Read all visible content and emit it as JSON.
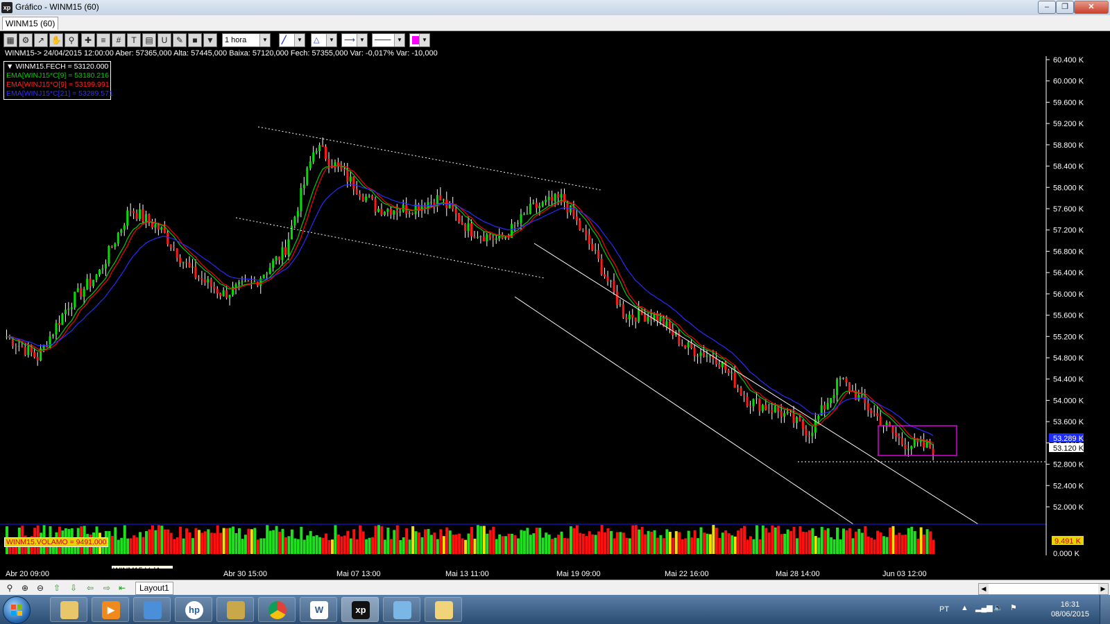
{
  "window": {
    "title": "Gráfico - WINM15 (60)",
    "app_icon": "xp"
  },
  "tab": {
    "label": "WINM15 (60)"
  },
  "toolbar": {
    "timeframe": "1 hora",
    "color_swatch": "#ff00ff"
  },
  "info": {
    "line": "WINM15-> 24/04/2015 12:00:00 Aber: 57365,000 Alta: 57445,000 Baixa: 57120,000 Fech: 57355,000 Var: -0,017% Var: -10,000"
  },
  "legend": {
    "close": "WINM15.FECH = 53120.000",
    "ema9c": "EMA[WINJ15*C[9] = 53180.216",
    "ema9o": "EMA[WINJ15*O[9] = 53199.991",
    "ema21c": "EMA[WINJ15*C[21] = 53289.571"
  },
  "price_axis": {
    "ticks": [
      "60.400 K",
      "60.000 K",
      "59.600 K",
      "59.200 K",
      "58.800 K",
      "58.400 K",
      "58.000 K",
      "57.600 K",
      "57.200 K",
      "56.800 K",
      "56.400 K",
      "56.000 K",
      "55.600 K",
      "55.200 K",
      "54.800 K",
      "54.400 K",
      "54.000 K",
      "53.600 K",
      "53.200 K",
      "52.800 K",
      "52.400 K",
      "52.000 K"
    ],
    "badge_ema": "53.289 K",
    "badge_close": "53.120 K"
  },
  "volume": {
    "label": "WINM15.VOLAMO = 9491.000",
    "badge": "9.491 K",
    "zero": "0.000 K",
    "tooltip": "WINM15.VolAmo"
  },
  "x_axis": {
    "labels": [
      "Abr 20 09:00",
      "Abr 30 15:00",
      "Mai 07 13:00",
      "Mai 13 11:00",
      "Mai 19 09:00",
      "Mai 22 16:00",
      "Mai 28 14:00",
      "Jun 03 12:00"
    ]
  },
  "layout_tab": "Layout1",
  "taskbar": {
    "lang": "PT",
    "time": "16:31",
    "date": "08/06/2015"
  },
  "chart_data": {
    "type": "candlestick",
    "series": [
      {
        "name": "WINM15.FECH",
        "close": [
          55200,
          54800,
          55800,
          56400,
          57600,
          57200,
          56400,
          56000,
          56200,
          56800,
          58800,
          58200,
          57600,
          57600,
          57800,
          57200,
          57000,
          57600,
          57800,
          56800,
          55600,
          55600,
          55000,
          54800,
          54000,
          53800,
          53400,
          54400,
          53800,
          53200,
          53100
        ]
      },
      {
        "name": "EMA[WINJ15*C[9]",
        "color": "#00cc00"
      },
      {
        "name": "EMA[WINJ15*O[9]",
        "color": "#ff0000"
      },
      {
        "name": "EMA[WINJ15*C[21]",
        "color": "#2020ff"
      }
    ],
    "ylim": [
      51800,
      60500
    ],
    "last_close": 53120,
    "last_volume": 9491
  }
}
